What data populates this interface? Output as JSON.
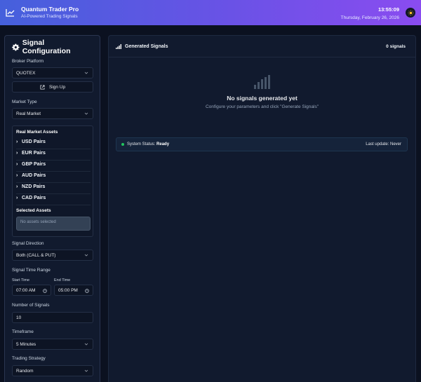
{
  "header": {
    "title": "Quantum Trader Pro",
    "subtitle": "AI-Powered Trading Signals",
    "time": "13:55:09",
    "date": "Thursday, February 26, 2026",
    "gradient": [
      "#4560dc",
      "#8a4cf0"
    ]
  },
  "sidebar": {
    "title": "Signal Configuration",
    "broker_label": "Broker Platform",
    "broker_value": "QUOTEX",
    "signup_label": "Sign Up",
    "market_type_label": "Market Type",
    "market_type_value": "Real Market",
    "assets_title": "Real Market Assets",
    "asset_groups": [
      "USD Pairs",
      "EUR Pairs",
      "GBP Pairs",
      "AUD Pairs",
      "NZD Pairs",
      "CAD Pairs"
    ],
    "selected_assets_label": "Selected Assets",
    "selected_assets_empty": "No assets selected",
    "direction_label": "Signal Direction",
    "direction_value": "Both (CALL & PUT)",
    "time_range_label": "Signal Time Range",
    "start_time_label": "Start Time",
    "start_time_value": "07:00 AM",
    "end_time_label": "End Time",
    "end_time_value": "05:00 PM",
    "num_signals_label": "Number of Signals",
    "num_signals_value": "10",
    "timeframe_label": "Timeframe",
    "timeframe_value": "5 Minutes",
    "strategy_label": "Trading Strategy",
    "strategy_value": "Random"
  },
  "main": {
    "title": "Generated Signals",
    "count": "0 signals",
    "empty_title": "No signals generated yet",
    "empty_subtitle": "Configure your parameters and click \"Generate Signals\"",
    "status_label": "System Status:",
    "status_value": "Ready",
    "last_update": "Last update: Never",
    "status_color": "#22c55e"
  }
}
